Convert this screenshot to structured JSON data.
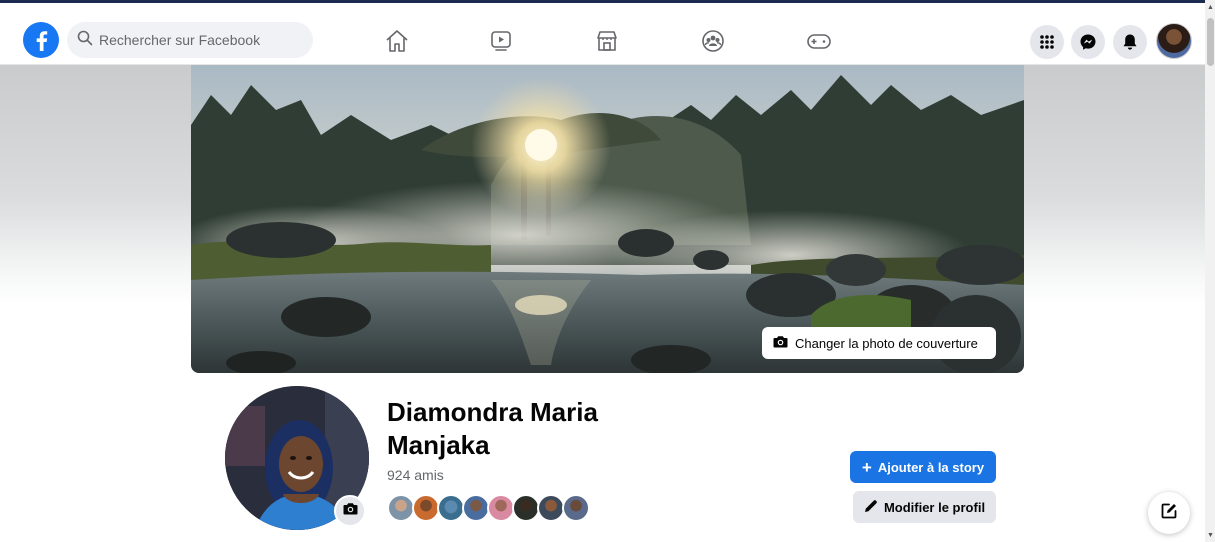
{
  "colors": {
    "brand": "#1877f2",
    "primary_button": "#1b74e4",
    "secondary_button": "#e4e6eb",
    "text_primary": "#050505",
    "text_secondary": "#65676b"
  },
  "navbar": {
    "logo_icon": "facebook-logo-icon",
    "search": {
      "placeholder": "Rechercher sur Facebook",
      "value": ""
    },
    "center_icons": [
      "home-icon",
      "watch-icon",
      "marketplace-icon",
      "groups-icon",
      "gaming-icon"
    ],
    "right_icons": [
      "menu-grid-icon",
      "messenger-icon",
      "notifications-icon",
      "account-avatar"
    ]
  },
  "cover": {
    "change_button_label": "Changer la photo de couverture",
    "button_icon": "camera-icon"
  },
  "profile": {
    "name": "Diamondra Maria Manjaka",
    "friends_count": "924 amis",
    "friend_avatar_count": 8,
    "camera_icon": "camera-icon"
  },
  "actions": {
    "add_story_label": "Ajouter à la story",
    "add_story_icon": "plus-icon",
    "edit_profile_label": "Modifier le profil",
    "edit_profile_icon": "pencil-icon"
  },
  "floating": {
    "compose_icon": "new-message-icon"
  }
}
